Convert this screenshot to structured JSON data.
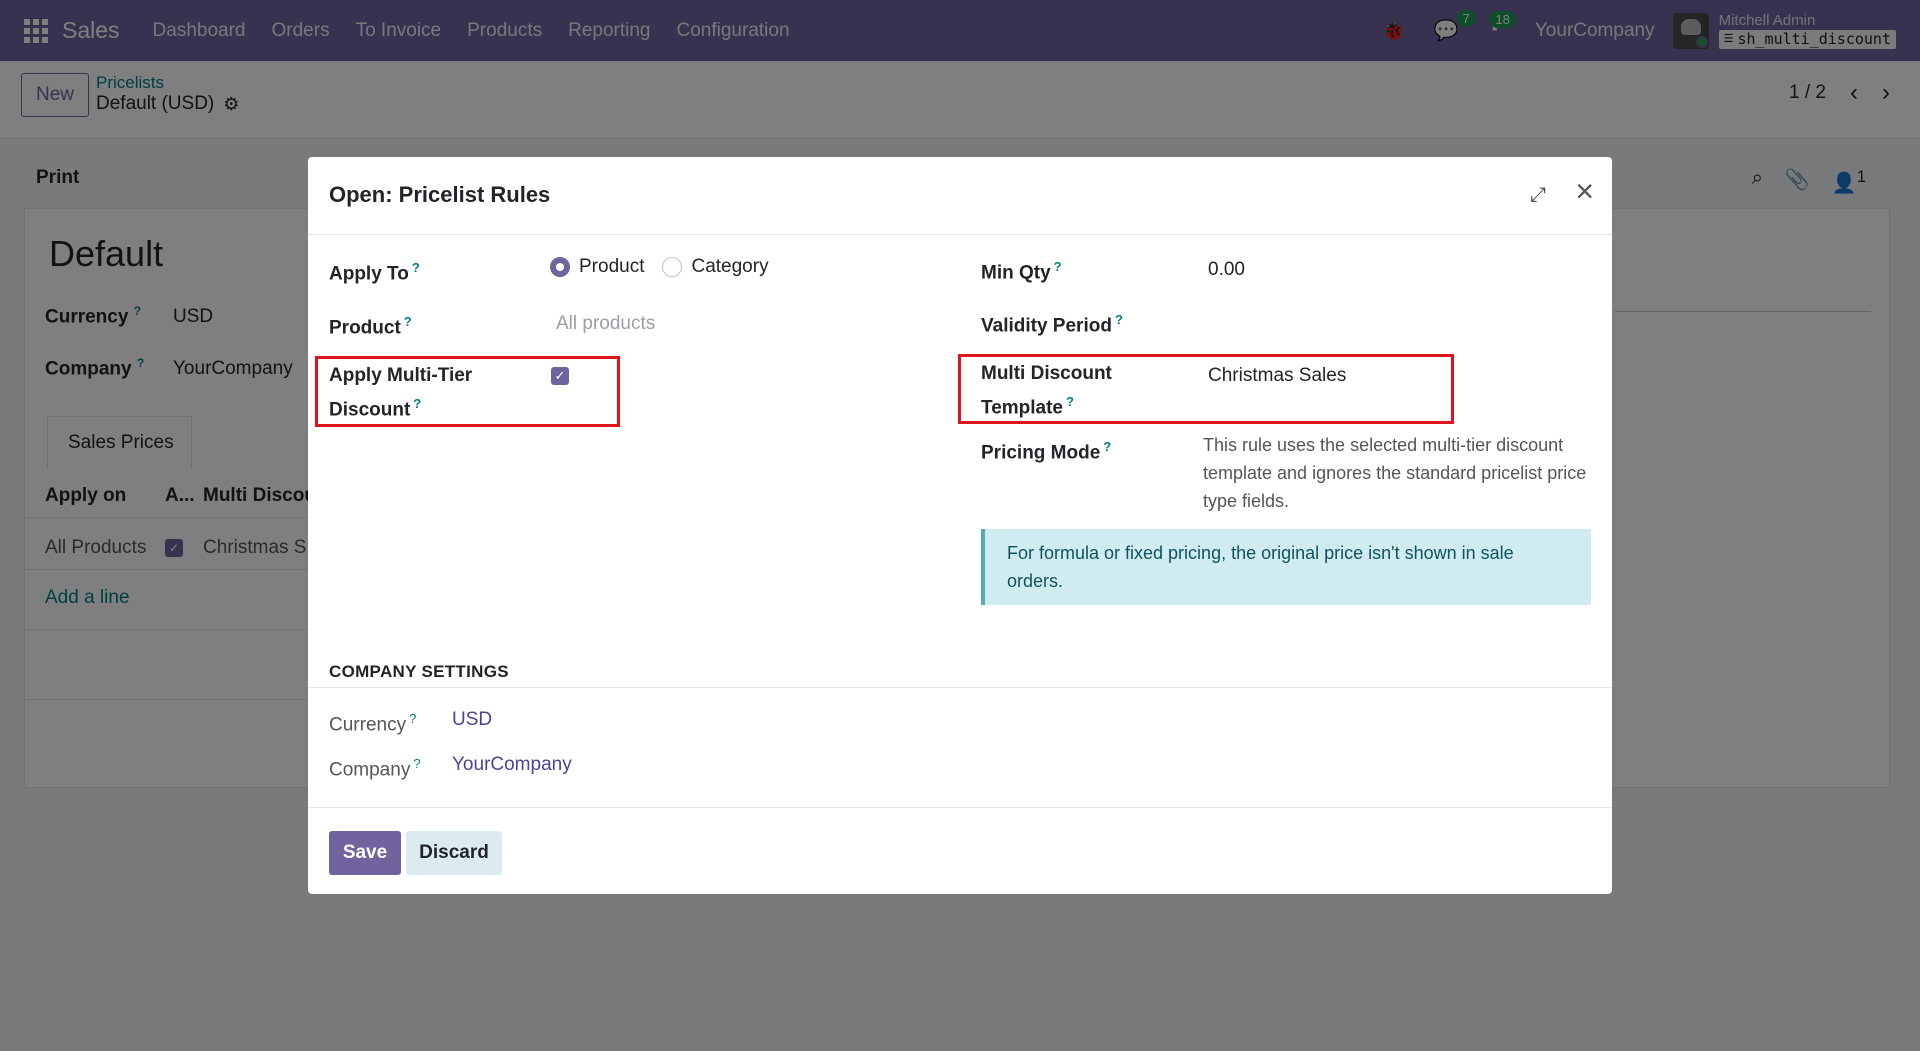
{
  "navbar": {
    "app_name": "Sales",
    "menu": [
      "Dashboard",
      "Orders",
      "To Invoice",
      "Products",
      "Reporting",
      "Configuration"
    ],
    "bug_icon": "🐞",
    "messages_count": "7",
    "activities_count": "18",
    "company": "YourCompany",
    "user_name": "Mitchell Admin",
    "database": "sh_multi_discount",
    "accent_color": "#71639e"
  },
  "control_panel": {
    "new_label": "New",
    "breadcrumb_parent": "Pricelists",
    "breadcrumb_current": "Default (USD)",
    "pager": "1 / 2"
  },
  "form": {
    "print_label": "Print",
    "title": "Default",
    "currency_label": "Currency",
    "currency_value": "USD",
    "company_label": "Company",
    "company_value": "YourCompany",
    "tab_label": "Sales Prices",
    "list_headers": [
      "Apply on",
      "A...",
      "Multi Discou"
    ],
    "list_row": {
      "apply_on": "All Products",
      "template": "Christmas S"
    },
    "add_line": "Add a line",
    "follower_count": "1"
  },
  "modal": {
    "title": "Open: Pricelist Rules",
    "apply_to_label": "Apply To",
    "apply_to_options": [
      "Product",
      "Category"
    ],
    "apply_to_selected": "Product",
    "product_label": "Product",
    "product_placeholder": "All products",
    "multi_tier_label_1": "Apply Multi-Tier",
    "multi_tier_label_2": "Discount",
    "multi_tier_checked": true,
    "min_qty_label": "Min Qty",
    "min_qty_value": "0.00",
    "validity_label": "Validity Period",
    "template_label_1": "Multi Discount",
    "template_label_2": "Template",
    "template_value": "Christmas Sales",
    "pricing_mode_label": "Pricing Mode",
    "pricing_mode_text": "This rule uses the selected multi-tier discount template and ignores the standard pricelist price type fields.",
    "info_text": "For formula or fixed pricing, the original price isn't shown in sale orders.",
    "section_title": "COMPANY SETTINGS",
    "currency_label": "Currency",
    "currency_value": "USD",
    "company_label": "Company",
    "company_value": "YourCompany",
    "save_label": "Save",
    "discard_label": "Discard",
    "highlight_color": "#e0141c"
  }
}
